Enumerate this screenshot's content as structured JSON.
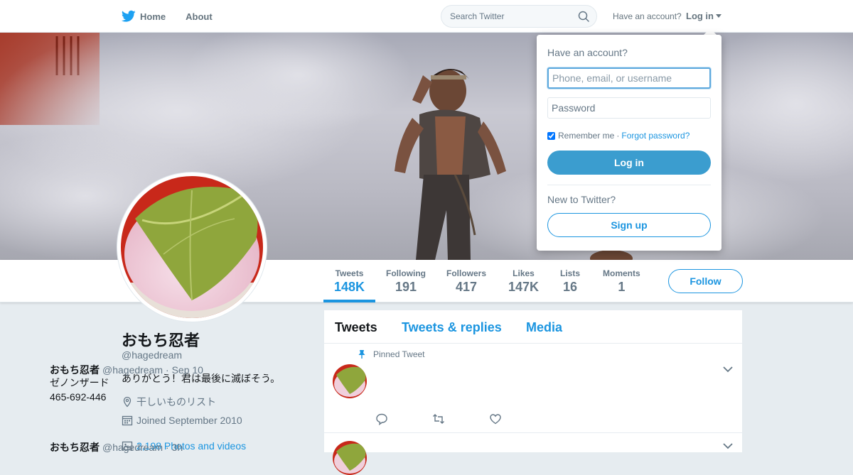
{
  "nav": {
    "home_label": "Home",
    "about_label": "About",
    "search_placeholder": "Search Twitter",
    "have_account_text": "Have an account?",
    "login_label": "Log in"
  },
  "profile": {
    "name": "おもち忍者",
    "handle": "@hagedream",
    "bio": "ありがとう！君は最後に滅ぼそう。",
    "location": "干しいものリスト",
    "joined": "Joined September 2010",
    "photos": "2,198 Photos and videos"
  },
  "stats": [
    {
      "label": "Tweets",
      "value": "148K"
    },
    {
      "label": "Following",
      "value": "191"
    },
    {
      "label": "Followers",
      "value": "417"
    },
    {
      "label": "Likes",
      "value": "147K"
    },
    {
      "label": "Lists",
      "value": "16"
    },
    {
      "label": "Moments",
      "value": "1"
    }
  ],
  "follow_label": "Follow",
  "timeline": {
    "tabs": [
      "Tweets",
      "Tweets & replies",
      "Media"
    ],
    "tweets": [
      {
        "pinned_label": "Pinned Tweet",
        "name": "おもち忍者",
        "handle": "@hagedream",
        "time": "· Sep 10",
        "line1": "ゼノンザード",
        "line2": "465-692-446"
      },
      {
        "name": "おもち忍者",
        "handle": "@hagedream",
        "time": "· 3h"
      }
    ]
  },
  "login_dropdown": {
    "title": "Have an account?",
    "username_placeholder": "Phone, email, or username",
    "password_placeholder": "Password",
    "remember_label": "Remember me",
    "separator": "·",
    "forgot_label": "Forgot password?",
    "login_button": "Log in",
    "new_text": "New to Twitter?",
    "signup_button": "Sign up"
  },
  "colors": {
    "accent": "#1b95e0",
    "login_button_bg": "#3b9dcf",
    "page_bg": "#e6ecf0"
  },
  "icons": [
    "twitter-bird-icon",
    "search-icon",
    "location-icon",
    "calendar-icon",
    "photo-icon",
    "pin-icon",
    "reply-icon",
    "retweet-icon",
    "like-icon",
    "chevron-down-icon"
  ]
}
